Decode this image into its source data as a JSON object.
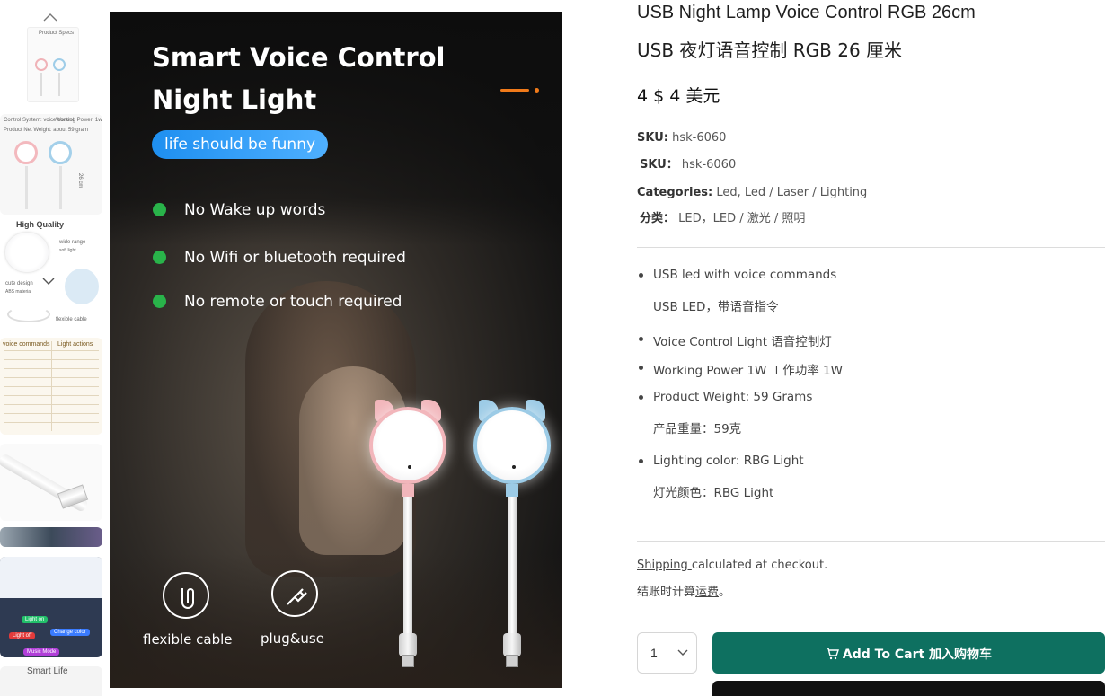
{
  "gallery": {
    "thumbnails": [
      {
        "caption": "Product Specs"
      },
      {
        "caption_a": "Control System: voice control",
        "caption_b": "Working Power: 1w",
        "caption_c": "Product Net Weight: about 59 gram",
        "caption_d": "26 cm"
      },
      {
        "caption": "High Quality",
        "caption_a": "wide range",
        "caption_b": "soft light",
        "caption_c": "cute design",
        "caption_d": "ABS material",
        "caption_e": "flexible cable"
      },
      {
        "header_a": "voice commands",
        "header_b": "Light actions"
      },
      {
        "caption": ""
      },
      {
        "caption": ""
      },
      {
        "caption_a": "Light on",
        "caption_b": "Change color",
        "caption_c": "Light off",
        "caption_d": "Music Mode"
      },
      {
        "caption": "Smart Life"
      }
    ]
  },
  "hero": {
    "title_line1": "Smart Voice Control",
    "title_line2": "Night Light",
    "pill": "life should be funny",
    "features": [
      "No Wake up words",
      "No Wifi or bluetooth required",
      "No remote or touch required"
    ],
    "icon_captions": [
      "flexible cable",
      "plug&use"
    ],
    "colors": {
      "accent": "#f07a1a",
      "pill": "#1e8ff0",
      "check": "#29b34a",
      "lamp_pink": "#f2b6bb",
      "lamp_blue": "#9ccbe6"
    }
  },
  "product": {
    "title_en": "USB Night Lamp Voice Control RGB 26cm",
    "title_zh": "USB 夜灯语音控制 RGB 26 厘米",
    "price": "4 $  4 美元",
    "sku_label": "SKU:",
    "sku_value": "hsk-6060",
    "sku_label_zh": "SKU：",
    "sku_value_zh": "hsk-6060",
    "categories_label": "Categories:",
    "categories_value": "Led, Led / Laser / Lighting",
    "categories_label_zh": "分类：",
    "categories_value_zh": "LED，LED / 激光 / 照明",
    "bullets": [
      {
        "text": "USB led with voice commands",
        "sub": "USB LED，带语音指令"
      },
      {
        "text": "Voice Control Light  语音控制灯",
        "sub": ""
      },
      {
        "text": "Working Power 1W  工作功率 1W",
        "sub": ""
      },
      {
        "text": "Product Weight: 59 Grams",
        "sub": "产品重量：59克"
      },
      {
        "text": "Lighting color: RBG Light",
        "sub": "灯光颜色：RBG Light"
      }
    ],
    "shipping_link": "Shipping ",
    "shipping_rest": "calculated at checkout.",
    "shipping_zh_prefix": "结账时计算",
    "shipping_zh_link": "运费",
    "shipping_zh_suffix": "。",
    "quantity": "1",
    "add_to_cart": "Add To Cart  加入购物车",
    "colors": {
      "add_to_cart_bg": "#0e7060",
      "buy_now_bg": "#111111"
    }
  }
}
